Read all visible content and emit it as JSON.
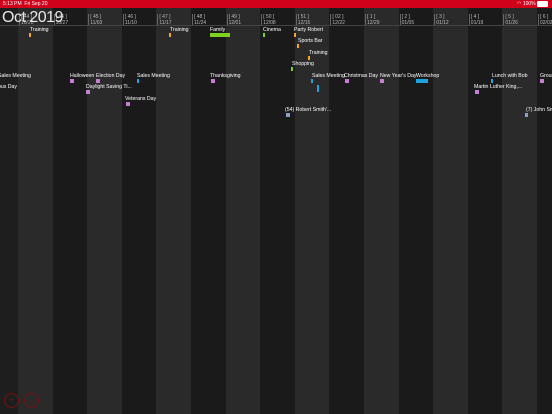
{
  "status_bar": {
    "time": "5:13 PM",
    "date": "Fri Sep 20",
    "battery": "100%",
    "wifi_icon": "wifi-icon",
    "battery_icon": "battery-icon"
  },
  "header": {
    "month_label": "Oct 2019",
    "weeks": [
      {
        "num": "[ 44 ]",
        "date": "10/20"
      },
      {
        "num": "[ 44 ]",
        "date": "10/27"
      },
      {
        "num": "[ 45 ]",
        "date": "11/03"
      },
      {
        "num": "[ 46 ]",
        "date": "11/10"
      },
      {
        "num": "[ 47 ]",
        "date": "11/17"
      },
      {
        "num": "[ 48 ]",
        "date": "11/24"
      },
      {
        "num": "[ 49 ]",
        "date": "12/01"
      },
      {
        "num": "[ 50 ]",
        "date": "12/08"
      },
      {
        "num": "[ 51 ]",
        "date": "12/15"
      },
      {
        "num": "[ 02 ]",
        "date": "12/22"
      },
      {
        "num": "[ 1 ]",
        "date": "12/29"
      },
      {
        "num": "[ 2 ]",
        "date": "01/05"
      },
      {
        "num": "[ 3 ]",
        "date": "01/12"
      },
      {
        "num": "[ 4 ]",
        "date": "01/19"
      },
      {
        "num": "[ 5 ]",
        "date": "01/26"
      },
      {
        "num": "[ 6 ]",
        "date": "02/02"
      }
    ]
  },
  "colors": {
    "status_bar": "#d0021b",
    "stripe_dark": "#1a1a1a",
    "stripe_light": "#2a2a2a",
    "holiday": "#c77dd6",
    "training": "#f5a623",
    "family": "#7ed321",
    "meeting": "#1fa2e0",
    "personal": "#8aa0c0"
  },
  "events": [
    {
      "label": "Training",
      "color": "#f5a623"
    },
    {
      "label": "Training",
      "color": "#f5a623"
    },
    {
      "label": "Family",
      "color": "#7ed321"
    },
    {
      "label": "Cinema",
      "color": "#7ed321"
    },
    {
      "label": "Party Robert",
      "color": "#f5a623"
    },
    {
      "label": "Sports Bar",
      "color": "#f5a623"
    },
    {
      "label": "Training",
      "color": "#f5a623"
    },
    {
      "label": "Shopping",
      "color": "#7ed321"
    },
    {
      "label": "Sales Meeting",
      "color": "#1fa2e0"
    },
    {
      "label": "Halloween",
      "color": "#c77dd6"
    },
    {
      "label": "Election Day",
      "color": "#c77dd6"
    },
    {
      "label": "Sales Meeting",
      "color": "#1fa2e0"
    },
    {
      "label": "Thanksgiving",
      "color": "#c77dd6"
    },
    {
      "label": "Sales Meeting",
      "color": "#1fa2e0"
    },
    {
      "label": "Christmas Day",
      "color": "#c77dd6"
    },
    {
      "label": "New Year's Day",
      "color": "#c77dd6"
    },
    {
      "label": "Workshop",
      "color": "#1fa2e0"
    },
    {
      "label": "Lunch with Bob",
      "color": "#1fa2e0"
    },
    {
      "label": "Groun",
      "color": "#c77dd6"
    },
    {
      "label": "bus Day",
      "color": "#c77dd6"
    },
    {
      "label": "Daylight Saving Ti...",
      "color": "#c77dd6"
    },
    {
      "label": "Martin Luther King,...",
      "color": "#c77dd6"
    },
    {
      "label": "Veterans Day",
      "color": "#c77dd6"
    },
    {
      "label": "(54) Robert Smith'...",
      "color": "#8aa0c0"
    },
    {
      "label": "(7) John Sm",
      "color": "#8aa0c0"
    }
  ],
  "fabs": [
    {
      "icon": "add-icon",
      "label": "+"
    },
    {
      "icon": "back-icon",
      "label": "←"
    }
  ]
}
